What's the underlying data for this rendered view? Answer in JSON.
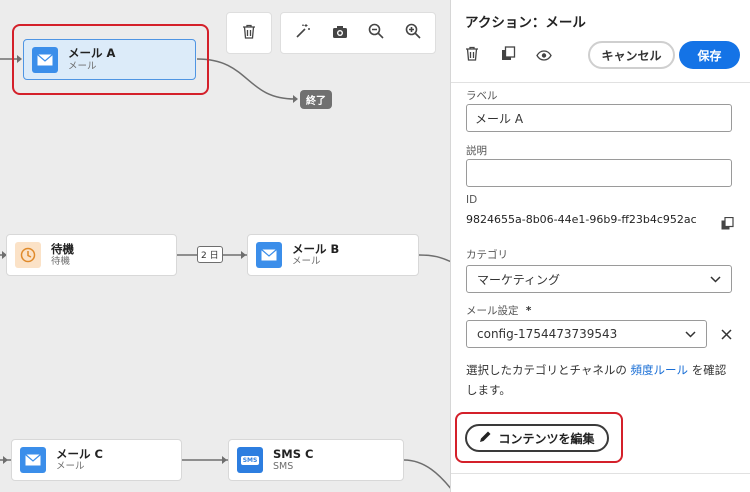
{
  "canvas": {
    "toolbar_delete": "delete-icon",
    "toolbar_tools": [
      "magic-wand-icon",
      "camera-icon",
      "zoom-out-icon",
      "zoom-in-icon"
    ],
    "nodes": {
      "mail_a": {
        "title": "メール A",
        "subtitle": "メール"
      },
      "end": {
        "label": "終了"
      },
      "wait": {
        "title": "待機",
        "subtitle": "待機"
      },
      "delay": {
        "label": "2 日"
      },
      "mail_b": {
        "title": "メール B",
        "subtitle": "メール"
      },
      "mail_c": {
        "title": "メール C",
        "subtitle": "メール"
      },
      "sms_c": {
        "title": "SMS C",
        "subtitle": "SMS",
        "icon_text": "SMS"
      }
    },
    "highlight_color": "#d4202a"
  },
  "panel": {
    "title": "アクション：メール",
    "cancel_label": "キャンセル",
    "save_label": "保存",
    "fields": {
      "label_caption": "ラベル",
      "label_value": "メール A",
      "description_caption": "説明",
      "description_value": "",
      "id_caption": "ID",
      "id_value": "9824655a-8b06-44e1-96b9-ff23b4c952ac",
      "category_caption": "カテゴリ",
      "category_value": "マーケティング",
      "mail_config_caption": "メール設定",
      "mail_config_required": "*",
      "mail_config_value": "config-1754473739543"
    },
    "help": {
      "before": "選択したカテゴリとチャネルの ",
      "link": "頻度ルール",
      "after": " を確認します。"
    },
    "edit_content_label": "コンテンツを編集",
    "accent_color": "#1473e6"
  }
}
